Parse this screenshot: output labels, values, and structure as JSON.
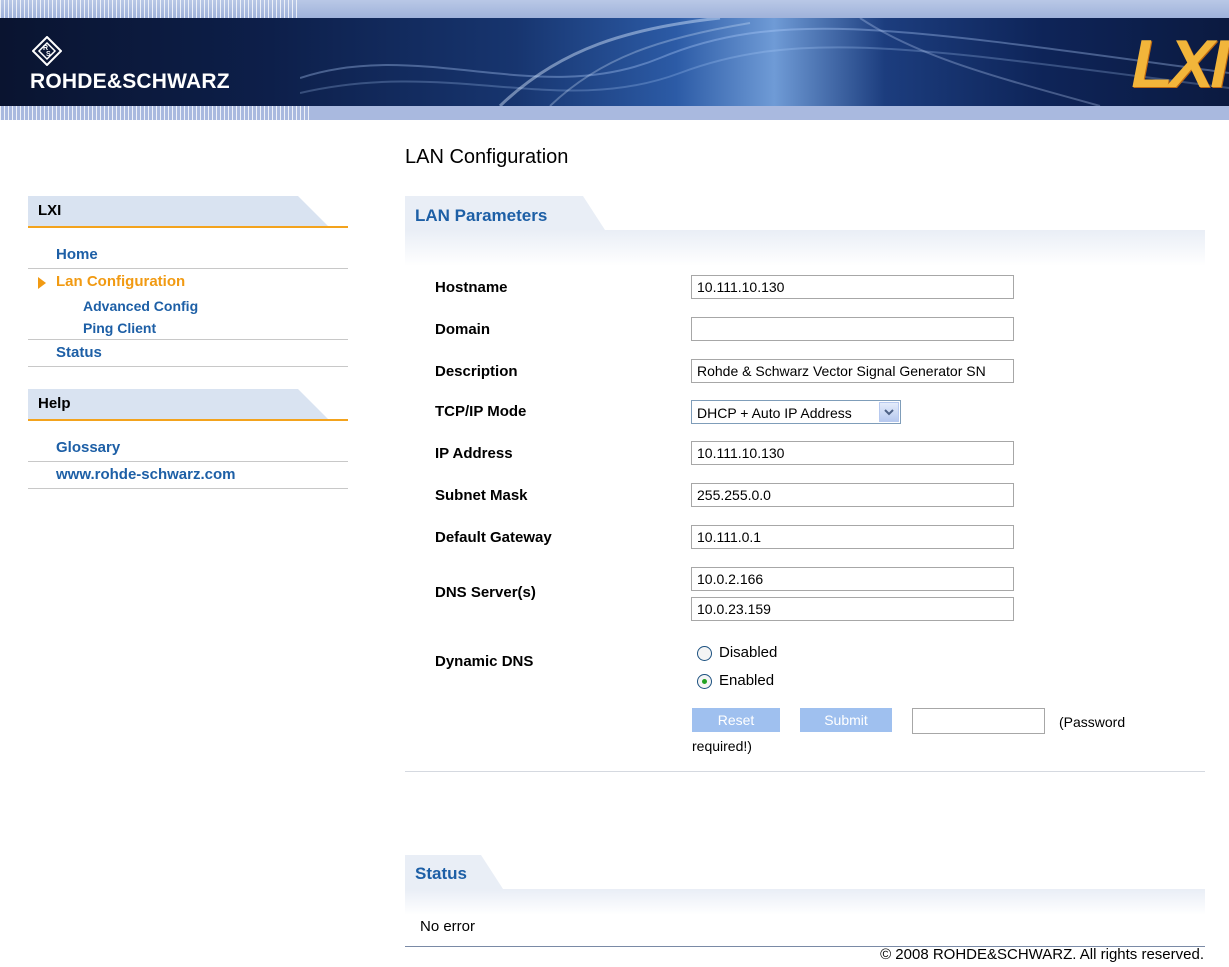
{
  "header": {
    "brand": "ROHDE&SCHWARZ",
    "lxi_logo": "LXI"
  },
  "sidebar": {
    "sections": [
      {
        "title": "LXI",
        "items": [
          {
            "label": "Home"
          },
          {
            "label": "Lan Configuration",
            "active": true,
            "subitems": [
              {
                "label": "Advanced Config"
              },
              {
                "label": "Ping Client"
              }
            ]
          },
          {
            "label": "Status"
          }
        ]
      },
      {
        "title": "Help",
        "items": [
          {
            "label": "Glossary"
          },
          {
            "label": "www.rohde-schwarz.com"
          }
        ]
      }
    ]
  },
  "main": {
    "title": "LAN Configuration",
    "params_section": {
      "title": "LAN Parameters",
      "hostname": {
        "label": "Hostname",
        "value": "10.111.10.130"
      },
      "domain": {
        "label": "Domain",
        "value": ""
      },
      "description": {
        "label": "Description",
        "value": "Rohde & Schwarz Vector Signal Generator SN"
      },
      "tcpip_mode": {
        "label": "TCP/IP Mode",
        "value": "DHCP + Auto IP Address"
      },
      "ip_address": {
        "label": "IP Address",
        "value": "10.111.10.130"
      },
      "subnet_mask": {
        "label": "Subnet Mask",
        "value": "255.255.0.0"
      },
      "default_gateway": {
        "label": "Default Gateway",
        "value": "10.111.0.1"
      },
      "dns_servers": {
        "label": "DNS Server(s)",
        "values": [
          "10.0.2.166",
          "10.0.23.159"
        ]
      },
      "dynamic_dns": {
        "label": "Dynamic DNS",
        "options": [
          "Disabled",
          "Enabled"
        ],
        "selected": "Enabled"
      },
      "reset_label": "Reset",
      "submit_label": "Submit",
      "password_value": "",
      "password_hint_1": "(Password",
      "password_hint_2": "required!)"
    },
    "status_section": {
      "title": "Status",
      "message": "No error"
    },
    "copyright": "© 2008 ROHDE&SCHWARZ. All rights reserved."
  },
  "colors": {
    "link_blue": "#1d5fa6",
    "active_orange": "#f19a12",
    "button_blue": "#9fc0ef",
    "radio_green": "#21a121"
  }
}
